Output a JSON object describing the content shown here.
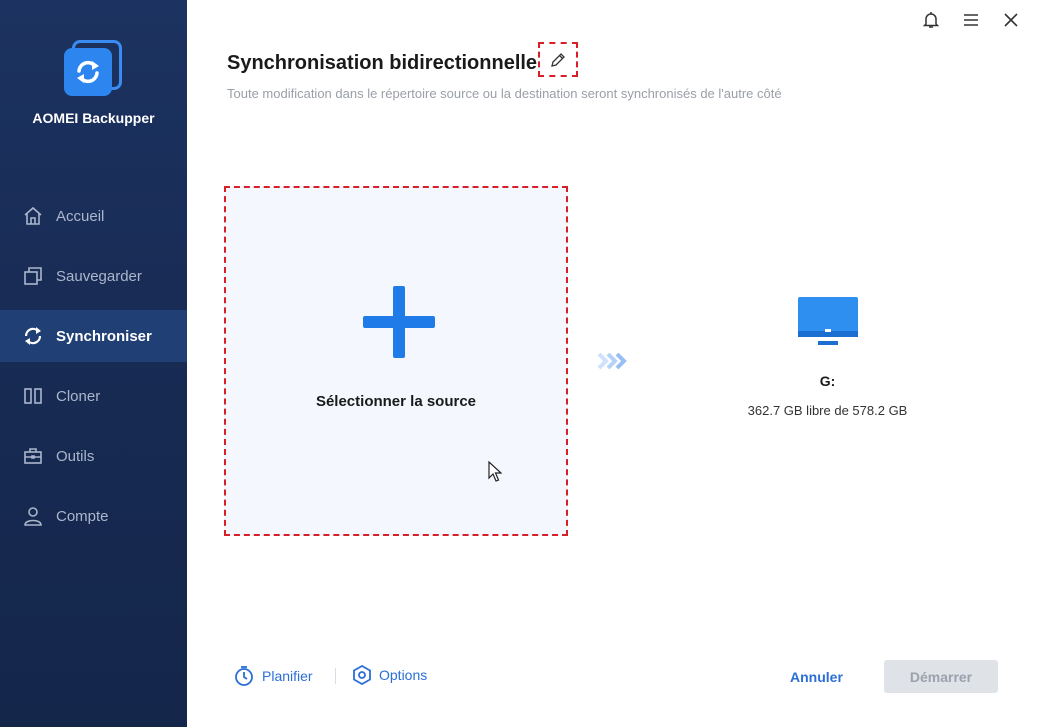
{
  "app": {
    "name": "AOMEI Backupper"
  },
  "sidebar": {
    "items": [
      {
        "label": "Accueil",
        "icon": "home-icon"
      },
      {
        "label": "Sauvegarder",
        "icon": "backup-icon"
      },
      {
        "label": "Synchroniser",
        "icon": "sync-icon",
        "active": true
      },
      {
        "label": "Cloner",
        "icon": "clone-icon"
      },
      {
        "label": "Outils",
        "icon": "tools-icon"
      },
      {
        "label": "Compte",
        "icon": "account-icon"
      }
    ]
  },
  "window_controls": [
    "bell-icon",
    "menu-icon",
    "close-icon"
  ],
  "header": {
    "title": "Synchronisation bidirectionnelle",
    "subtitle": "Toute modification dans le répertoire source ou la destination seront synchronisés de l'autre côté"
  },
  "source": {
    "label": "Sélectionner la source"
  },
  "destination": {
    "name": "G:",
    "space": "362.7 GB libre de 578.2 GB"
  },
  "footer": {
    "schedule_label": "Planifier",
    "options_label": "Options",
    "cancel_label": "Annuler",
    "start_label": "Démarrer"
  },
  "colors": {
    "accent": "#1f7be8",
    "sidebar_bg": "#172a52",
    "sidebar_active": "#203f74",
    "highlight_border": "#d61f26",
    "disabled_button": "#dfe2e7"
  }
}
